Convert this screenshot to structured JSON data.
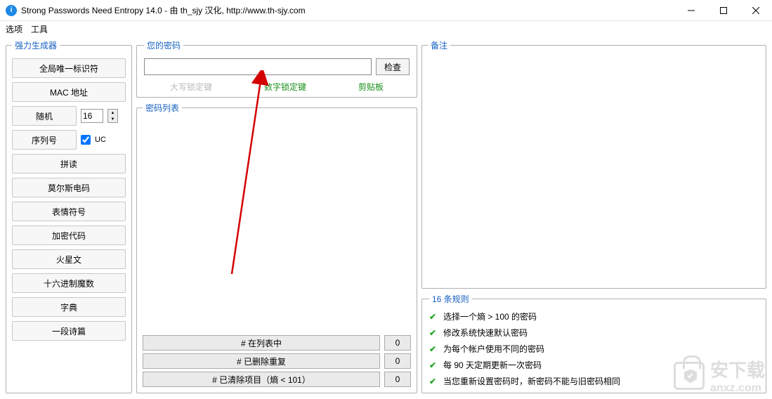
{
  "window": {
    "title": "Strong Passwords Need Entropy 14.0 - 由 th_sjy 汉化, http://www.th-sjy.com"
  },
  "menu": {
    "options": "选项",
    "tools": "工具"
  },
  "generators": {
    "legend": "强力生成器",
    "guid": "全局唯一标识符",
    "mac": "MAC 地址",
    "random": "随机",
    "random_len": "16",
    "serial": "序列号",
    "serial_uc": "UC",
    "pinyin": "拼读",
    "morse": "莫尔斯电码",
    "emoji": "表情符号",
    "crypto": "加密代码",
    "mars": "火星文",
    "hex": "十六进制魔数",
    "dict": "字典",
    "poem": "一段诗篇"
  },
  "password": {
    "legend": "您的密码",
    "value": "",
    "check": "检查",
    "caps": "大写锁定键",
    "num": "数字锁定键",
    "clip": "剪贴板"
  },
  "pwlist": {
    "legend": "密码列表",
    "in_list": "# 在列表中",
    "in_list_val": "0",
    "dedup": "# 已删除重复",
    "dedup_val": "0",
    "purged": "# 已清除项目（熵 < 101）",
    "purged_val": "0"
  },
  "notes": {
    "legend": "备注"
  },
  "rules": {
    "legend": "16 条规则",
    "items": [
      "选择一个熵 > 100 的密码",
      "修改系统快速默认密码",
      "为每个帐户使用不同的密码",
      "每 90 天定期更新一次密码",
      "当您重新设置密码时，新密码不能与旧密码相同"
    ]
  },
  "watermark": {
    "text": "安下载",
    "url": "anxz.com"
  }
}
